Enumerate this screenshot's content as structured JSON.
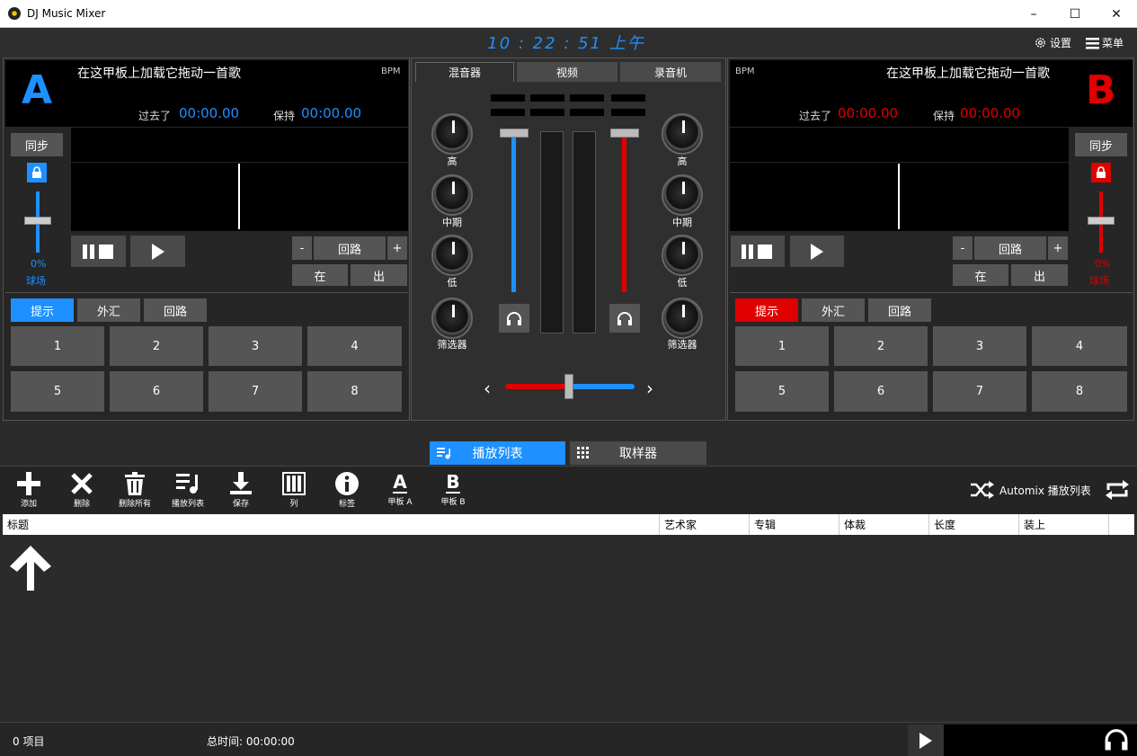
{
  "window": {
    "title": "DJ Music Mixer",
    "minimize": "–",
    "maximize": "☐",
    "close": "✕"
  },
  "top": {
    "clock": "10 : 22 : 51 上午",
    "settings": "设置",
    "menu": "菜单"
  },
  "deckA": {
    "letter": "A",
    "song": "在这甲板上加载它拖动一首歌",
    "bpm": "BPM",
    "elapsed_label": "过去了",
    "elapsed": "00:00.00",
    "remain_label": "保持",
    "remain": "00:00.00",
    "sync": "同步",
    "pitch_pct": "0%",
    "pitch_label": "球场",
    "loop_minus": "-",
    "loop": "回路",
    "loop_plus": "+",
    "in": "在",
    "out": "出",
    "tabs": [
      "提示",
      "外汇",
      "回路"
    ],
    "pads": [
      "1",
      "2",
      "3",
      "4",
      "5",
      "6",
      "7",
      "8"
    ],
    "color": "#1e90ff"
  },
  "deckB": {
    "letter": "B",
    "song": "在这甲板上加载它拖动一首歌",
    "bpm": "BPM",
    "elapsed_label": "过去了",
    "elapsed": "00:00.00",
    "remain_label": "保持",
    "remain": "00:00.00",
    "sync": "同步",
    "pitch_pct": "0%",
    "pitch_label": "球场",
    "loop_minus": "-",
    "loop": "回路",
    "loop_plus": "+",
    "in": "在",
    "out": "出",
    "tabs": [
      "提示",
      "外汇",
      "回路"
    ],
    "pads": [
      "1",
      "2",
      "3",
      "4",
      "5",
      "6",
      "7",
      "8"
    ],
    "color": "#e00000"
  },
  "mixer": {
    "tabs": [
      "混音器",
      "视频",
      "录音机"
    ],
    "knobs_left": [
      "高",
      "中期",
      "低",
      "筛选器"
    ],
    "knobs_right": [
      "高",
      "中期",
      "低",
      "筛选器"
    ],
    "crossfader_left": "‹",
    "crossfader_right": "›"
  },
  "lower_tabs": {
    "playlist": "播放列表",
    "sampler": "取样器"
  },
  "toolbar": {
    "add": "添加",
    "delete": "删除",
    "delete_all": "删除所有",
    "playlist": "播放列表",
    "save": "保存",
    "columns": "列",
    "tags": "标签",
    "deck_a": "甲板 A",
    "deck_b": "甲板 B",
    "deck_a_icon": "A",
    "deck_b_icon": "B",
    "automix": "Automix 播放列表"
  },
  "table": {
    "columns": [
      "标题",
      "艺术家",
      "专辑",
      "体裁",
      "长度",
      "装上"
    ]
  },
  "status": {
    "items": "0 项目",
    "total_time": "总时间: 00:00:00"
  }
}
